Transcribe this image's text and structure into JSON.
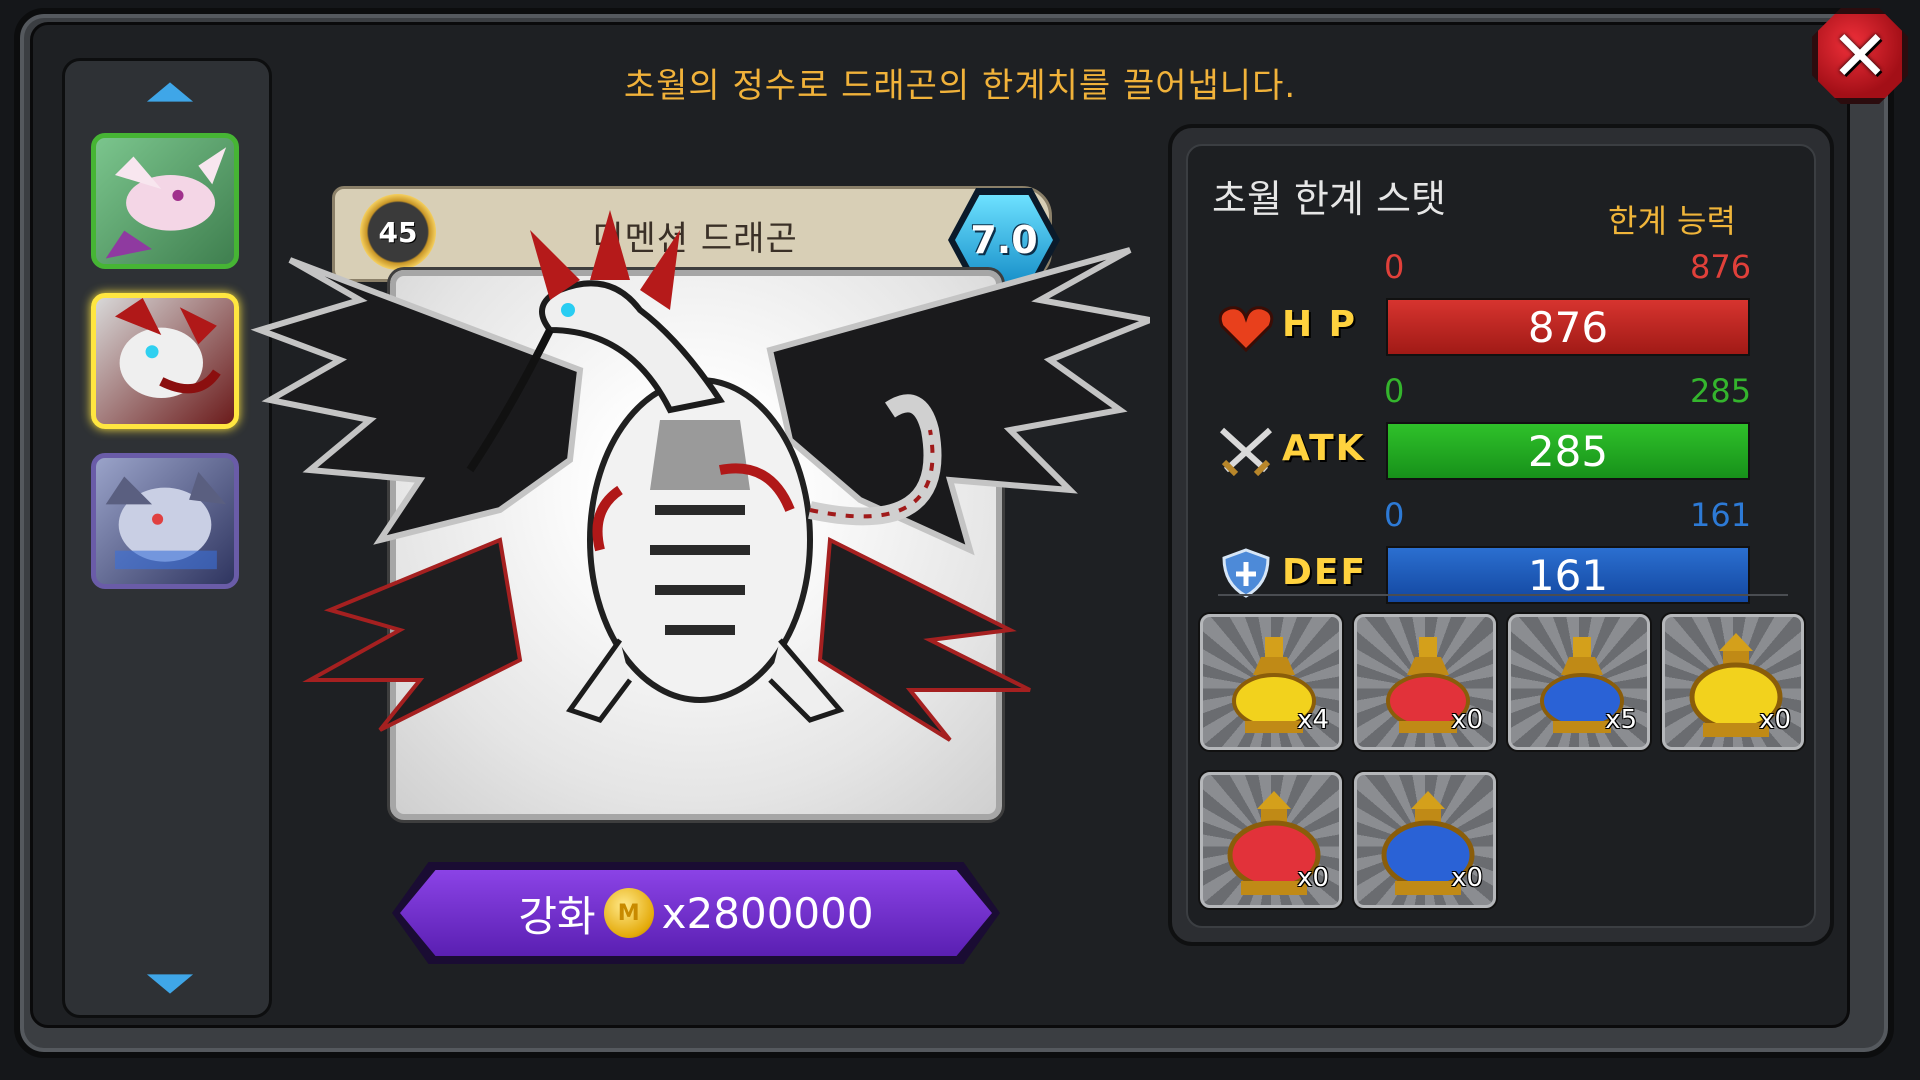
{
  "header": {
    "description": "초월의 정수로 드래곤의 한계치를 끌어냅니다.",
    "close_icon": "close-icon"
  },
  "sidebar": {
    "up_icon": "chevron-up-icon",
    "down_icon": "chevron-down-icon",
    "thumbnails": [
      {
        "name": "dragon-thumbnail-1",
        "border": "#46b534"
      },
      {
        "name": "dragon-thumbnail-2",
        "border": "#ffe640",
        "selected": true
      },
      {
        "name": "dragon-thumbnail-3",
        "border": "#6a5ca8"
      }
    ]
  },
  "card": {
    "level": "45",
    "name": "디멘션 드래곤",
    "grade": "7.0"
  },
  "upgrade": {
    "label": "강화",
    "coin_letter": "M",
    "cost": "x2800000"
  },
  "stats": {
    "title": "초월 한계 스탯",
    "subtitle": "한계 능력",
    "items": [
      {
        "name": "H P",
        "icon": "heart-icon",
        "min": "0",
        "max": "876",
        "value": "876",
        "color": "#e23b31"
      },
      {
        "name": "ATK",
        "icon": "crossed-swords-icon",
        "min": "0",
        "max": "285",
        "value": "285",
        "color": "#2fb52a"
      },
      {
        "name": "DEF",
        "icon": "shield-icon",
        "min": "0",
        "max": "161",
        "value": "161",
        "color": "#2d7ad6"
      }
    ]
  },
  "items": [
    {
      "name": "yellow-essence-small",
      "count": "x4",
      "color": "#f2d21d"
    },
    {
      "name": "red-essence-small",
      "count": "x0",
      "color": "#e2323a"
    },
    {
      "name": "blue-essence-small",
      "count": "x5",
      "color": "#2a62d6"
    },
    {
      "name": "yellow-essence-large",
      "count": "x0",
      "color": "#f2d21d"
    },
    {
      "name": "red-essence-large",
      "count": "x0",
      "color": "#e2323a"
    },
    {
      "name": "blue-essence-large",
      "count": "x0",
      "color": "#2a62d6"
    }
  ]
}
